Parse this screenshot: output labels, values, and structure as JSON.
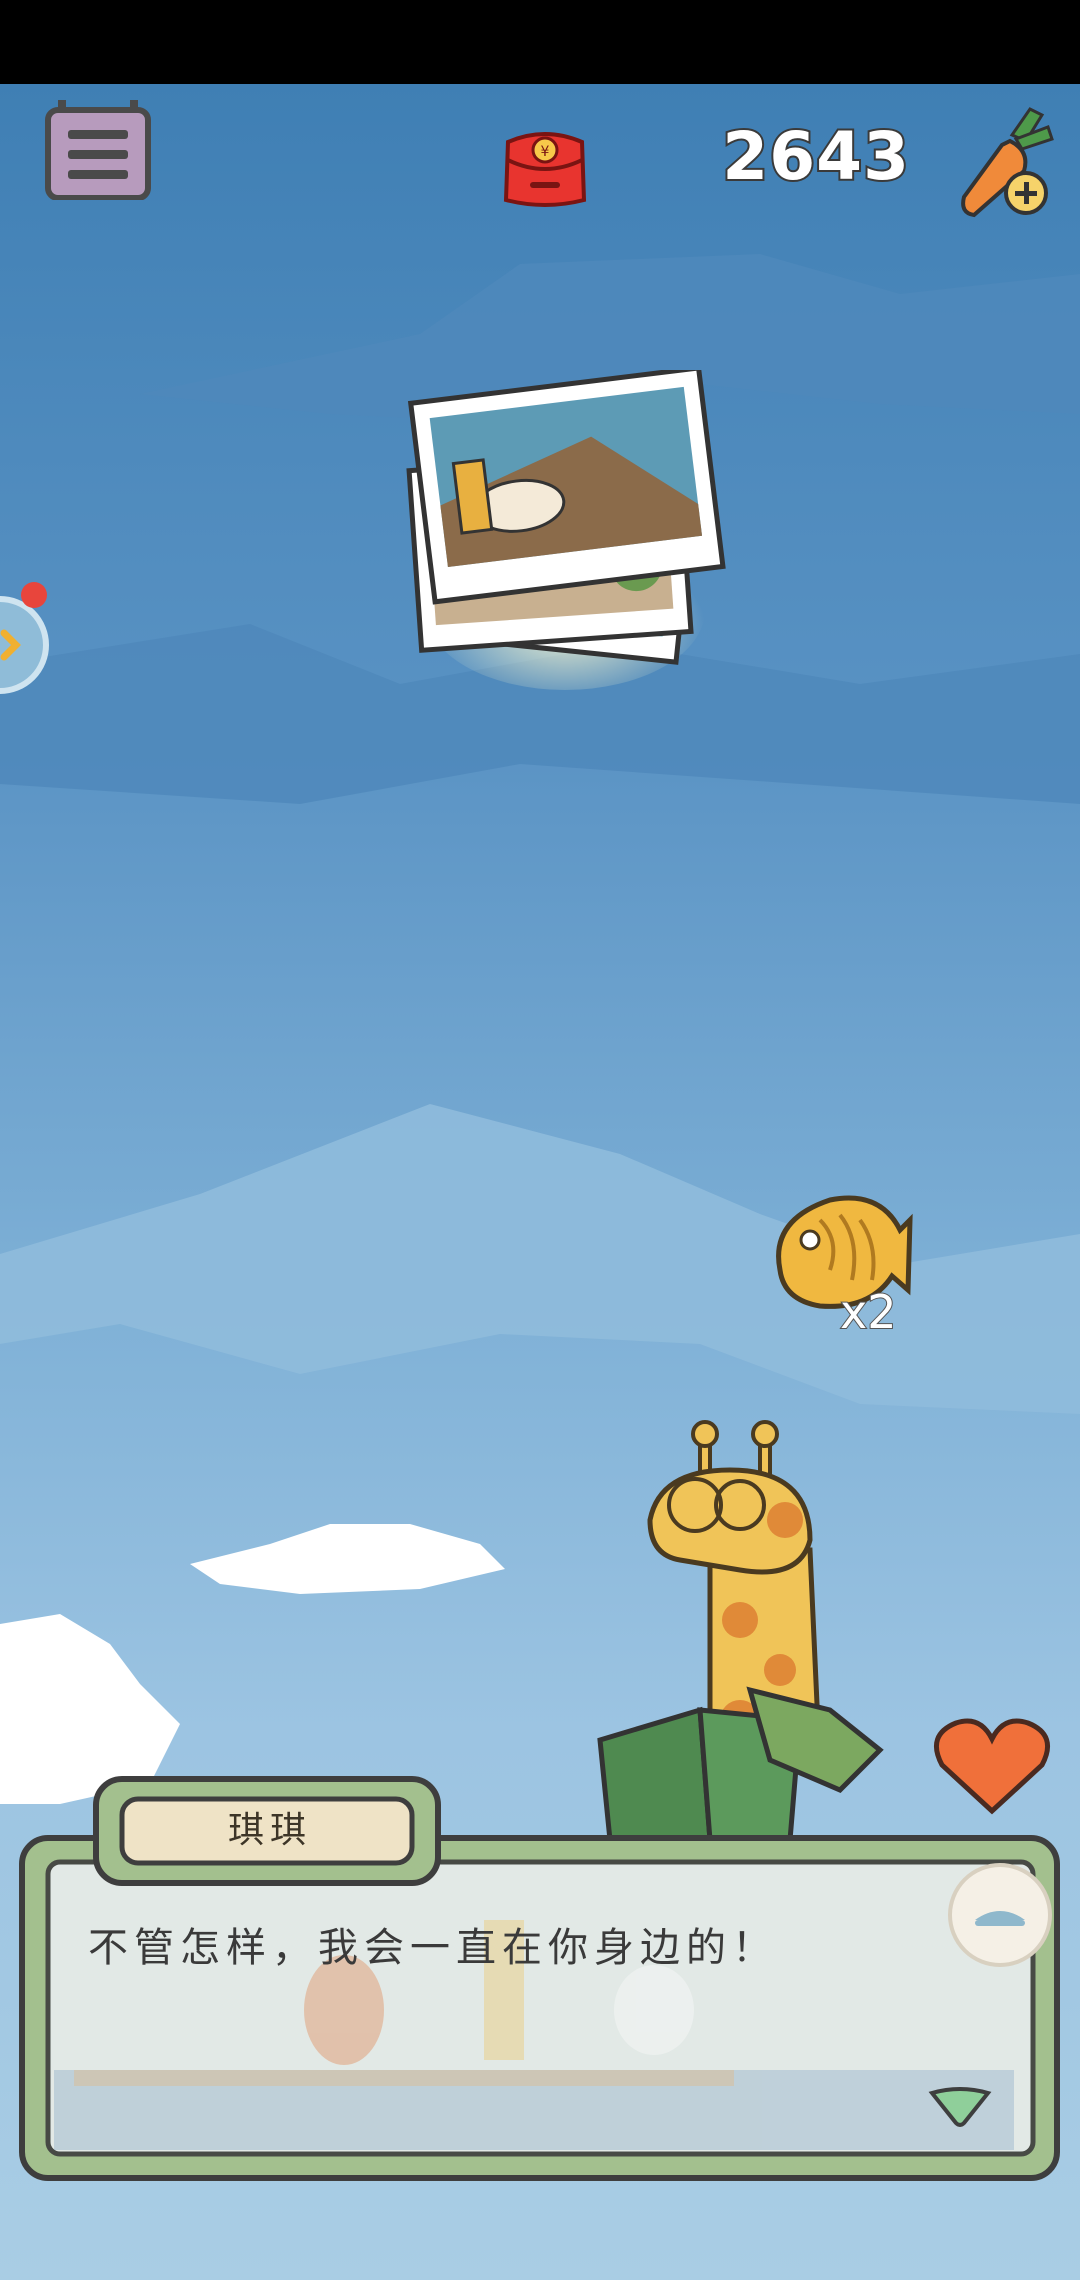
{
  "hud": {
    "carrot_count": "2643",
    "icons": [
      "menu-icon",
      "red-packet-icon",
      "carrot-add-icon",
      "side-expand-icon"
    ]
  },
  "scene": {
    "reward_multiplier": "x2",
    "reward_item": "taiyaki-fish-icon",
    "photo_item": "photo-stack-icon"
  },
  "dialog": {
    "speaker": "琪琪",
    "text": "不管怎样，我会一直在你身边的！"
  },
  "colors": {
    "sky": "#5a93c4",
    "dialog_border": "#6f9a5f",
    "name_plate": "#efe3c6",
    "heart": "#f0703a"
  }
}
